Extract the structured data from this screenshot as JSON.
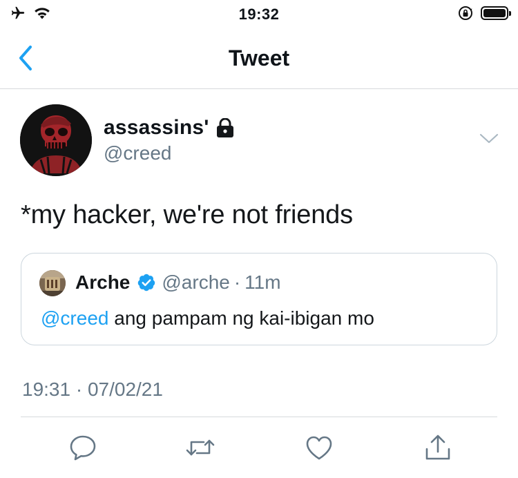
{
  "status_bar": {
    "time": "19:32",
    "icons": [
      "airplane-icon",
      "wifi-icon",
      "orientation-lock-icon",
      "battery-icon"
    ],
    "battery_level": 1.0
  },
  "nav": {
    "title": "Tweet",
    "back_icon": "chevron-left-icon",
    "accent_color": "#1da1f2"
  },
  "tweet": {
    "display_name": "assassins'",
    "protected_icon": "lock-icon",
    "handle": "@creed",
    "menu_icon": "chevron-down-icon",
    "text": "*my hacker, we're not friends",
    "timestamp": "19:31 · 07/02/21"
  },
  "quote": {
    "name": "Arche",
    "verified_icon": "verified-badge-icon",
    "handle": "@arche",
    "separator": "·",
    "time": "11m",
    "mention": "@creed",
    "text": " ang pampam ng kai-ibigan mo"
  },
  "actions": [
    {
      "name": "reply",
      "icon": "reply-icon"
    },
    {
      "name": "retweet",
      "icon": "retweet-icon"
    },
    {
      "name": "like",
      "icon": "heart-icon"
    },
    {
      "name": "share",
      "icon": "share-icon"
    }
  ],
  "colors": {
    "secondary_text": "#657786",
    "border": "#ccd6dd",
    "link": "#1da1f2"
  }
}
